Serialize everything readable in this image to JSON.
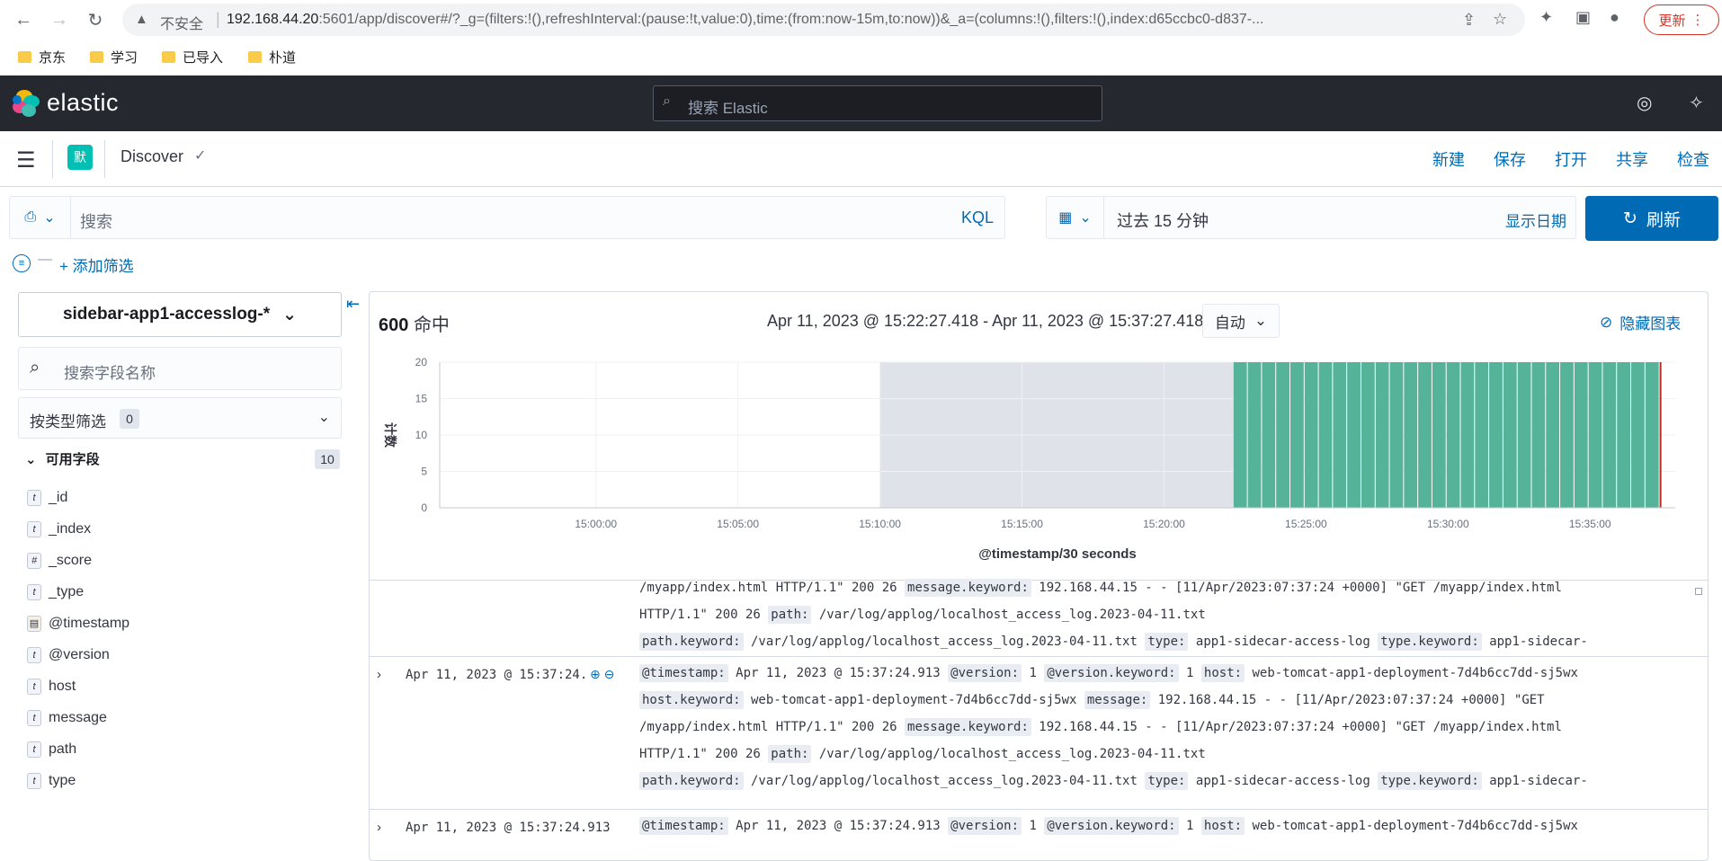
{
  "browser": {
    "insecure_label": "不安全",
    "url_host": "192.168.44.20",
    "url_rest": ":5601/app/discover#/?_g=(filters:!(),refreshInterval:(pause:!t,value:0),time:(from:now-15m,to:now))&_a=(columns:!(),filters:!(),index:d65ccbc0-d837-...",
    "update_label": "更新",
    "bookmarks": [
      "京东",
      "学习",
      "已导入",
      "朴道"
    ]
  },
  "header": {
    "logo_text": "elastic",
    "search_placeholder": "搜索 Elastic"
  },
  "app_bar": {
    "space_initial": "默",
    "app_title": "Discover",
    "links": [
      "新建",
      "保存",
      "打开",
      "共享",
      "检查"
    ]
  },
  "query": {
    "placeholder": "搜索",
    "language": "KQL",
    "time_range": "过去 15 分钟",
    "show_dates": "显示日期",
    "refresh": "刷新",
    "add_filter": "+ 添加筛选"
  },
  "sidebar": {
    "index_pattern": "sidebar-app1-accesslog-*",
    "field_search_placeholder": "搜索字段名称",
    "type_filter_label": "按类型筛选",
    "type_filter_count": "0",
    "available_label": "可用字段",
    "available_count": "10",
    "fields": [
      {
        "type": "t",
        "name": "_id"
      },
      {
        "type": "t",
        "name": "_index"
      },
      {
        "type": "#",
        "name": "_score"
      },
      {
        "type": "t",
        "name": "_type"
      },
      {
        "type": "date",
        "name": "@timestamp"
      },
      {
        "type": "t",
        "name": "@version"
      },
      {
        "type": "t",
        "name": "host"
      },
      {
        "type": "t",
        "name": "message"
      },
      {
        "type": "t",
        "name": "path"
      },
      {
        "type": "t",
        "name": "type"
      }
    ]
  },
  "main": {
    "hits_count": "600",
    "hits_label": "命中",
    "time_range_label": "Apr 11, 2023 @ 15:22:27.418 - Apr 11, 2023 @ 15:37:27.418",
    "interval": "自动",
    "hide_chart": "隐藏图表"
  },
  "chart_data": {
    "type": "bar",
    "xlabel": "@timestamp/30 seconds",
    "ylabel": "计数",
    "ylim": [
      0,
      20
    ],
    "yticks": [
      0,
      5,
      10,
      15,
      20
    ],
    "x_range": [
      "15:00:00",
      "15:38:00"
    ],
    "xticks": [
      "15:00:00",
      "15:05:00",
      "15:10:00",
      "15:15:00",
      "15:20:00",
      "15:25:00",
      "15:30:00",
      "15:35:00"
    ],
    "shaded_range": [
      "15:10:00",
      "15:22:27"
    ],
    "bar_range": [
      "15:22:27",
      "15:37:27"
    ],
    "bar_interval_seconds": 30,
    "bar_value": 20,
    "bar_color": "#54b399"
  },
  "docs": [
    {
      "time": "",
      "lines": [
        [
          {
            "v": "/myapp/index.html HTTP/1.1\" 200 26 "
          },
          {
            "k": "message.keyword:"
          },
          {
            "v": " 192.168.44.15 - - [11/Apr/2023:07:37:24 +0000] \"GET /myapp/index.html"
          }
        ],
        [
          {
            "v": "HTTP/1.1\" 200 26 "
          },
          {
            "k": "path:"
          },
          {
            "v": " /var/log/applog/localhost_access_log.2023-04-11.txt"
          }
        ],
        [
          {
            "k": "path.keyword:"
          },
          {
            "v": " /var/log/applog/localhost_access_log.2023-04-11.txt "
          },
          {
            "k": "type:"
          },
          {
            "v": " app1-sidecar-access-log "
          },
          {
            "k": "type.keyword:"
          },
          {
            "v": " app1-sidecar-"
          }
        ]
      ]
    },
    {
      "time": "Apr 11, 2023 @ 15:37:24.913",
      "lines": [
        [
          {
            "k": "@timestamp:"
          },
          {
            "v": " Apr 11, 2023 @ 15:37:24.913 "
          },
          {
            "k": "@version:"
          },
          {
            "v": " 1 "
          },
          {
            "k": "@version.keyword:"
          },
          {
            "v": " 1 "
          },
          {
            "k": "host:"
          },
          {
            "v": " web-tomcat-app1-deployment-7d4b6cc7dd-sj5wx"
          }
        ],
        [
          {
            "k": "host.keyword:"
          },
          {
            "v": " web-tomcat-app1-deployment-7d4b6cc7dd-sj5wx "
          },
          {
            "k": "message:"
          },
          {
            "v": " 192.168.44.15 - - [11/Apr/2023:07:37:24 +0000] \"GET"
          }
        ],
        [
          {
            "v": "/myapp/index.html HTTP/1.1\" 200 26 "
          },
          {
            "k": "message.keyword:"
          },
          {
            "v": " 192.168.44.15 - - [11/Apr/2023:07:37:24 +0000] \"GET /myapp/index.html"
          }
        ],
        [
          {
            "v": "HTTP/1.1\" 200 26 "
          },
          {
            "k": "path:"
          },
          {
            "v": " /var/log/applog/localhost_access_log.2023-04-11.txt"
          }
        ],
        [
          {
            "k": "path.keyword:"
          },
          {
            "v": " /var/log/applog/localhost_access_log.2023-04-11.txt "
          },
          {
            "k": "type:"
          },
          {
            "v": " app1-sidecar-access-log "
          },
          {
            "k": "type.keyword:"
          },
          {
            "v": " app1-sidecar-"
          }
        ]
      ]
    },
    {
      "time": "Apr 11, 2023 @ 15:37:24.913",
      "lines": [
        [
          {
            "k": "@timestamp:"
          },
          {
            "v": " Apr 11, 2023 @ 15:37:24.913 "
          },
          {
            "k": "@version:"
          },
          {
            "v": " 1 "
          },
          {
            "k": "@version.keyword:"
          },
          {
            "v": " 1 "
          },
          {
            "k": "host:"
          },
          {
            "v": " web-tomcat-app1-deployment-7d4b6cc7dd-sj5wx"
          }
        ]
      ]
    }
  ]
}
